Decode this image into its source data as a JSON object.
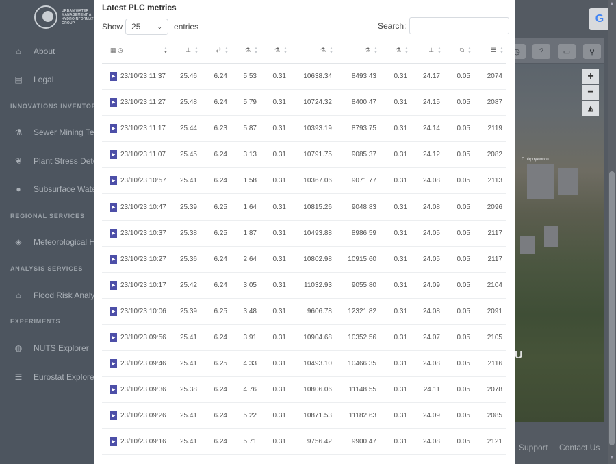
{
  "sidebar": {
    "logo_lines": [
      "URBAN WATER",
      "MANAGEMENT A",
      "HYDROINFORMAT",
      "GROUP"
    ],
    "items": [
      {
        "label": "About",
        "icon": "home-icon"
      },
      {
        "label": "Legal",
        "icon": "document-icon"
      },
      {
        "section": "INNOVATIONS INVENTORY"
      },
      {
        "label": "Sewer Mining Te",
        "icon": "flask-icon"
      },
      {
        "label": "Plant Stress Dete",
        "icon": "leaf-icon"
      },
      {
        "label": "Subsurface Wate",
        "icon": "drop-icon"
      },
      {
        "section": "REGIONAL SERVICES"
      },
      {
        "label": "Meteorological H",
        "icon": "layers-icon"
      },
      {
        "section": "ANALYSIS SERVICES"
      },
      {
        "label": "Flood Risk Analy",
        "icon": "house-water-icon"
      },
      {
        "section": "EXPERIMENTS"
      },
      {
        "label": "NUTS Explorer",
        "icon": "globe-icon"
      },
      {
        "label": "Eurostat Explorer",
        "icon": "database-icon"
      }
    ]
  },
  "modal": {
    "title": "Latest PLC metrics",
    "show_label": "Show",
    "page_size": "25",
    "entries_label": "entries",
    "search_label": "Search:",
    "search_value": ""
  },
  "table": {
    "rows": [
      [
        "23/10/23 11:37",
        "25.46",
        "6.24",
        "5.53",
        "0.31",
        "10638.34",
        "8493.43",
        "0.31",
        "24.17",
        "0.05",
        "2074"
      ],
      [
        "23/10/23 11:27",
        "25.48",
        "6.24",
        "5.79",
        "0.31",
        "10724.32",
        "8400.47",
        "0.31",
        "24.15",
        "0.05",
        "2087"
      ],
      [
        "23/10/23 11:17",
        "25.44",
        "6.23",
        "5.87",
        "0.31",
        "10393.19",
        "8793.75",
        "0.31",
        "24.14",
        "0.05",
        "2119"
      ],
      [
        "23/10/23 11:07",
        "25.45",
        "6.24",
        "3.13",
        "0.31",
        "10791.75",
        "9085.37",
        "0.31",
        "24.12",
        "0.05",
        "2082"
      ],
      [
        "23/10/23 10:57",
        "25.41",
        "6.24",
        "1.58",
        "0.31",
        "10367.06",
        "9071.77",
        "0.31",
        "24.08",
        "0.05",
        "2113"
      ],
      [
        "23/10/23 10:47",
        "25.39",
        "6.25",
        "1.64",
        "0.31",
        "10815.26",
        "9048.83",
        "0.31",
        "24.08",
        "0.05",
        "2096"
      ],
      [
        "23/10/23 10:37",
        "25.38",
        "6.25",
        "1.87",
        "0.31",
        "10493.88",
        "8986.59",
        "0.31",
        "24.05",
        "0.05",
        "2117"
      ],
      [
        "23/10/23 10:27",
        "25.36",
        "6.24",
        "2.64",
        "0.31",
        "10802.98",
        "10915.60",
        "0.31",
        "24.05",
        "0.05",
        "2117"
      ],
      [
        "23/10/23 10:17",
        "25.42",
        "6.24",
        "3.05",
        "0.31",
        "11032.93",
        "9055.80",
        "0.31",
        "24.09",
        "0.05",
        "2104"
      ],
      [
        "23/10/23 10:06",
        "25.39",
        "6.25",
        "3.48",
        "0.31",
        "9606.78",
        "12321.82",
        "0.31",
        "24.08",
        "0.05",
        "2091"
      ],
      [
        "23/10/23 09:56",
        "25.41",
        "6.24",
        "3.91",
        "0.31",
        "10904.68",
        "10352.56",
        "0.31",
        "24.07",
        "0.05",
        "2105"
      ],
      [
        "23/10/23 09:46",
        "25.41",
        "6.25",
        "4.33",
        "0.31",
        "10493.10",
        "10466.35",
        "0.31",
        "24.08",
        "0.05",
        "2116"
      ],
      [
        "23/10/23 09:36",
        "25.38",
        "6.24",
        "4.76",
        "0.31",
        "10806.06",
        "11148.55",
        "0.31",
        "24.11",
        "0.05",
        "2078"
      ],
      [
        "23/10/23 09:26",
        "25.41",
        "6.24",
        "5.22",
        "0.31",
        "10871.53",
        "11182.63",
        "0.31",
        "24.09",
        "0.05",
        "2085"
      ],
      [
        "23/10/23 09:16",
        "25.41",
        "6.24",
        "5.71",
        "0.31",
        "9756.42",
        "9900.47",
        "0.31",
        "24.08",
        "0.05",
        "2121"
      ]
    ]
  },
  "map": {
    "google_letter": "G",
    "zoom_in": "+",
    "zoom_out": "−",
    "place_label": "Π. Φραγκιάκου",
    "watermark_letter": "U"
  },
  "footer": {
    "support": "Support",
    "contact": "Contact Us"
  },
  "colors": {
    "accent": "#4d4fa8",
    "sidebar_bg": "#4d555f"
  }
}
